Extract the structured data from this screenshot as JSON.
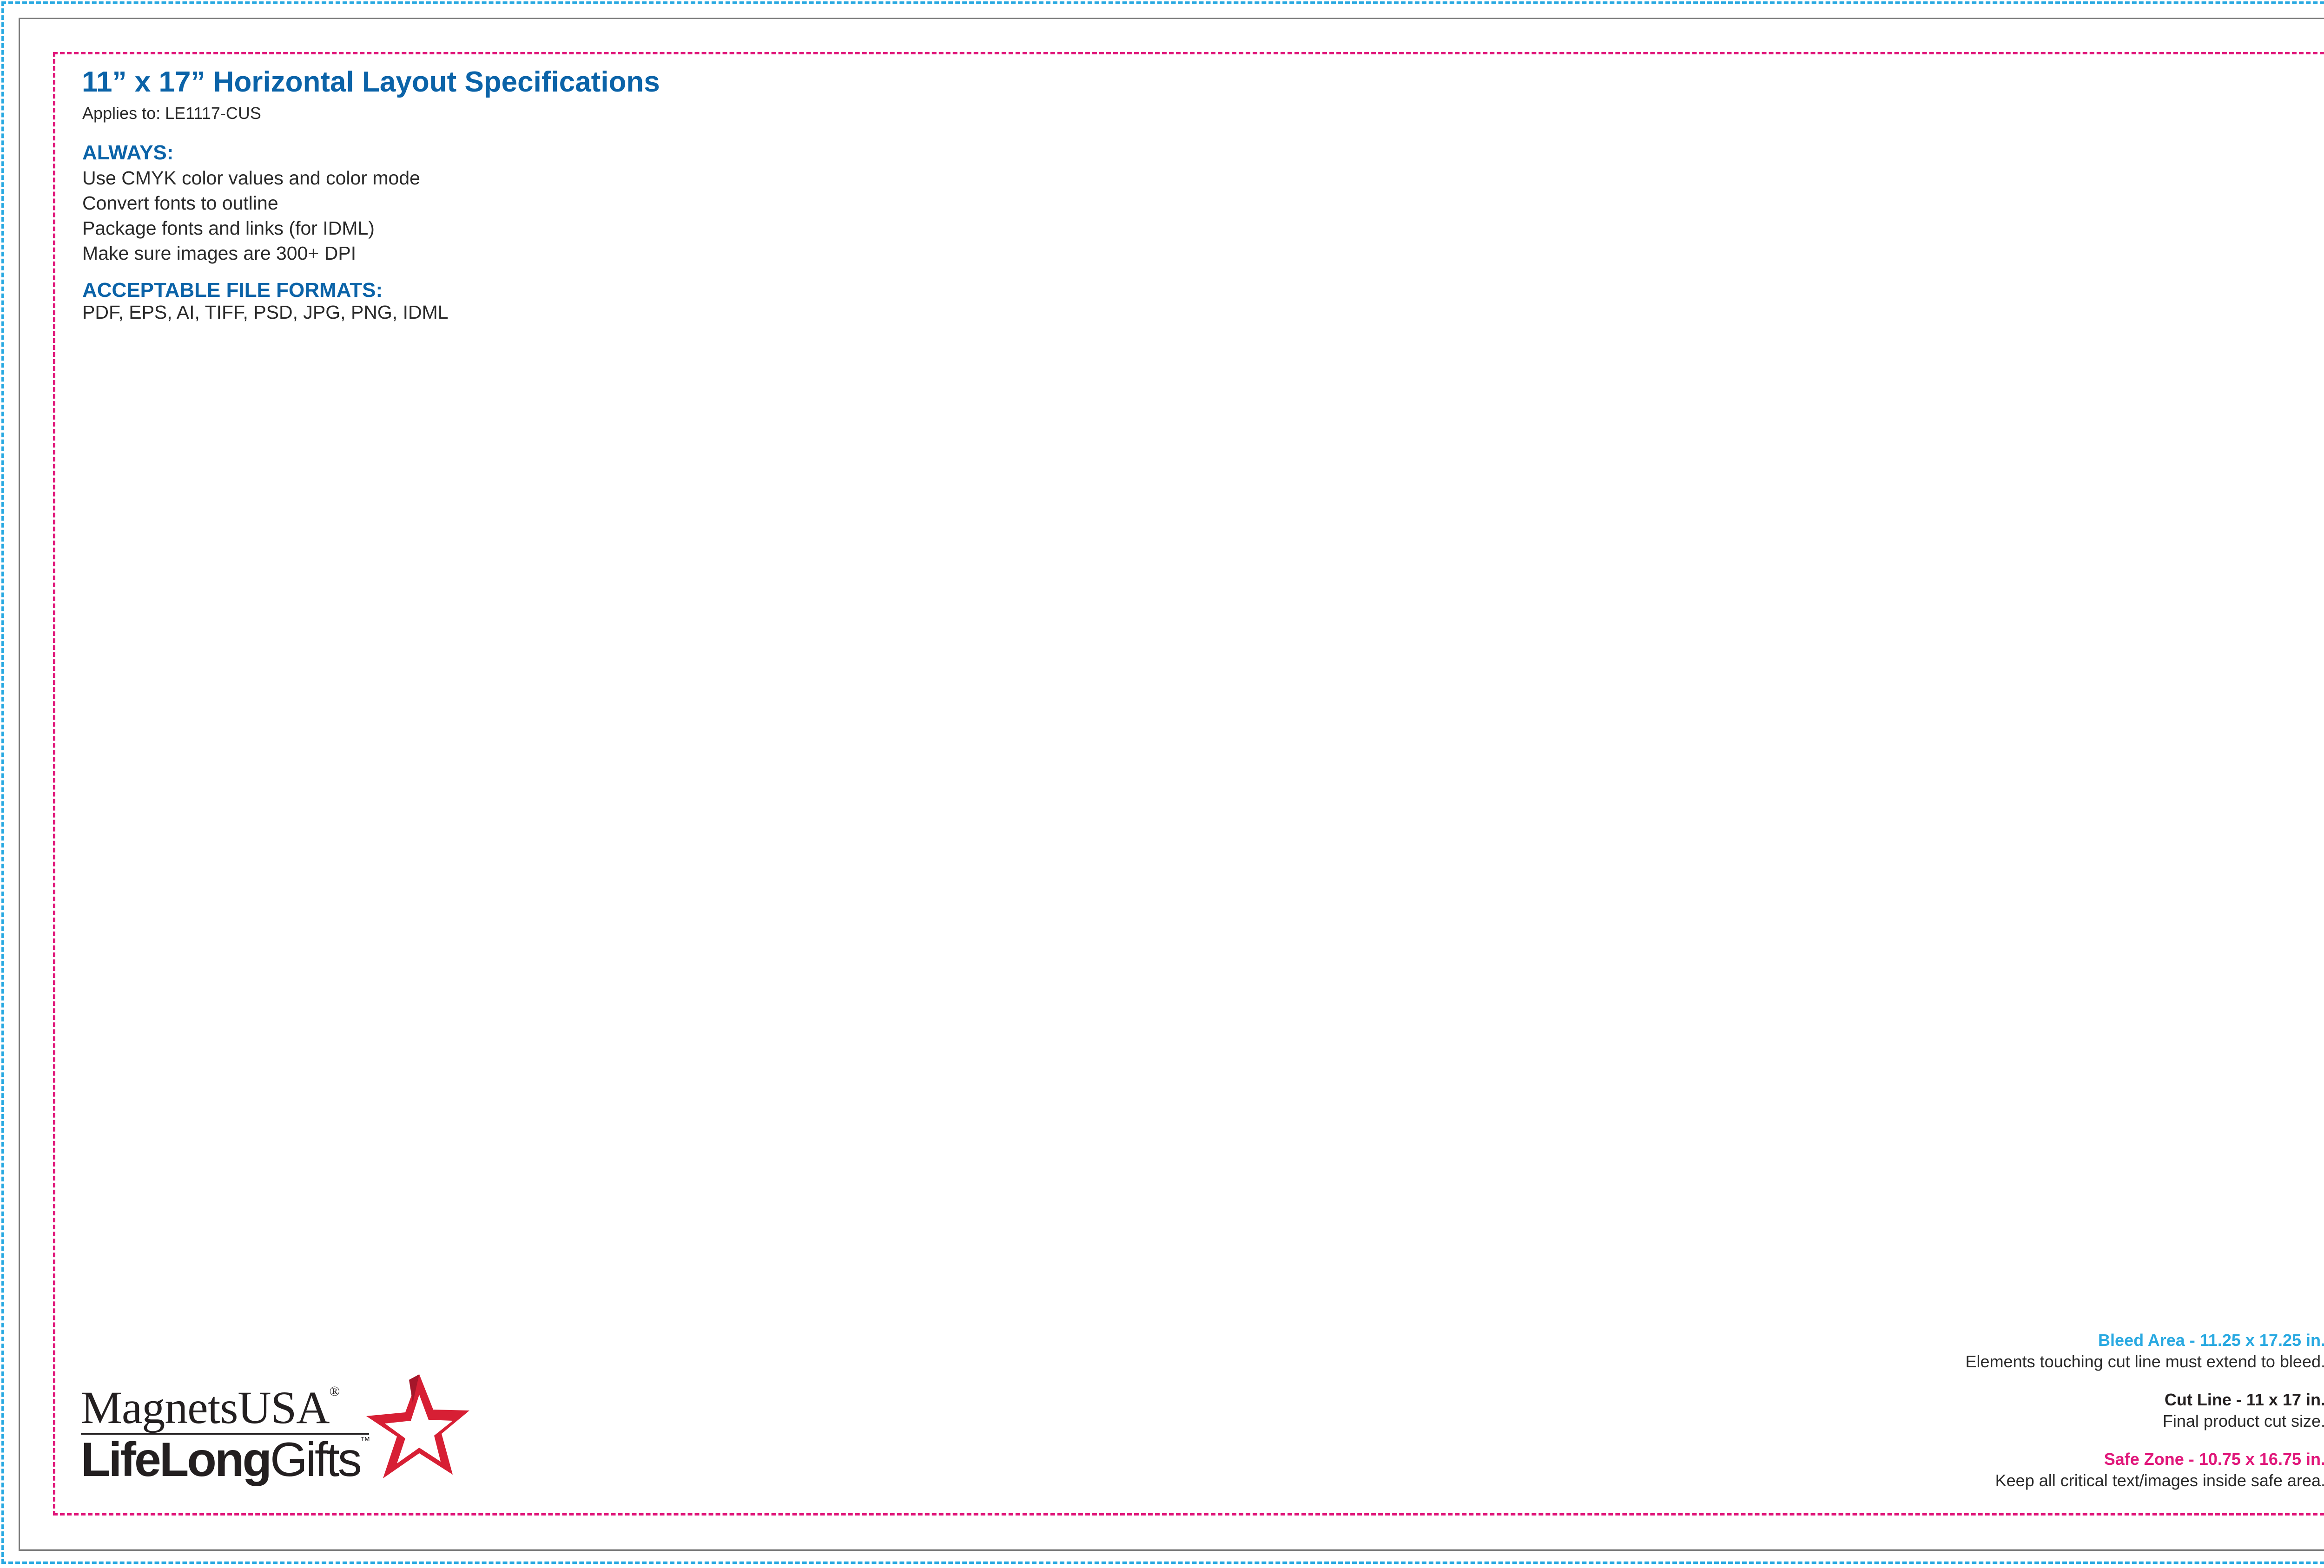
{
  "colors": {
    "bleed": "#29a9e1",
    "cut": "#231f20",
    "safe": "#e0177a",
    "heading": "#0b63a8",
    "star": "#d71f34"
  },
  "header": {
    "title": "11” x 17” Horizontal Layout Specifications",
    "applies_to": "Applies to: LE1117-CUS"
  },
  "always": {
    "heading": "ALWAYS:",
    "items": [
      "Use CMYK color values and color mode",
      "Convert fonts to outline",
      "Package fonts and links (for IDML)",
      "Make sure images are 300+ DPI"
    ]
  },
  "formats": {
    "heading": "ACCEPTABLE FILE FORMATS:",
    "list": "PDF, EPS, AI, TIFF, PSD, JPG, PNG, IDML"
  },
  "logo": {
    "top_text": "MagnetsUSA",
    "top_mark": "®",
    "bottom_bold": "LifeLong",
    "bottom_regular": "Gifts",
    "bottom_mark": "™",
    "icon": "star-icon"
  },
  "legend": {
    "bleed": {
      "title": "Bleed Area - 11.25 x 17.25 in.",
      "description": "Elements touching cut line must extend to bleed."
    },
    "cut": {
      "title": "Cut Line - 11 x 17 in.",
      "description": "Final product cut size."
    },
    "safe": {
      "title": "Safe Zone - 10.75 x 16.75 in.",
      "description": "Keep all critical text/images inside safe area."
    }
  }
}
